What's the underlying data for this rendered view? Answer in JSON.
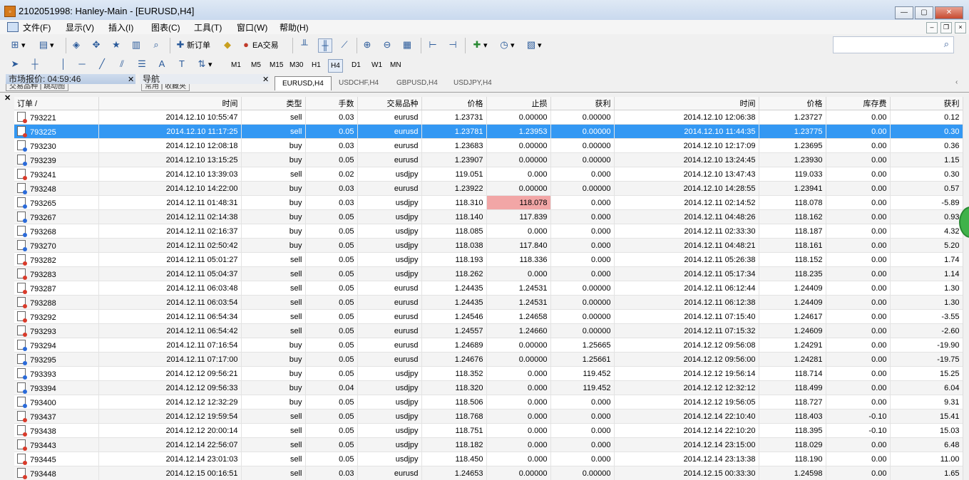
{
  "window": {
    "title": "2102051998: Hanley-Main - [EURUSD,H4]",
    "minimize": "—",
    "maximize": "▢",
    "close": "✕"
  },
  "menu": [
    "文件(F)",
    "显示(V)",
    "插入(I)",
    "图表(C)",
    "工具(T)",
    "窗口(W)",
    "帮助(H)"
  ],
  "toolbar": {
    "new_order": "新订单",
    "ea_trading": "EA交易"
  },
  "search": {
    "value": ""
  },
  "timeframes": [
    "M1",
    "M5",
    "M15",
    "M30",
    "H1",
    "H4",
    "D1",
    "W1",
    "MN"
  ],
  "active_timeframe": "H4",
  "panels": {
    "market_watch": "市场报价: 04:59:46",
    "navigator": "导航",
    "market_tabs": "交易品种 | 跳动图",
    "nav_tabs": "常用 | 收藏夹"
  },
  "chart_tabs": [
    "EURUSD,H4",
    "USDCHF,H4",
    "GBPUSD,H4",
    "USDJPY,H4"
  ],
  "table": {
    "headers": [
      "订单 /",
      "时间",
      "类型",
      "手数",
      "交易品种",
      "价格",
      "止损",
      "获利",
      "时间",
      "价格",
      "库存费",
      "获利"
    ],
    "rows": [
      {
        "o": "793221",
        "t1": "2014.12.10 10:55:47",
        "type": "sell",
        "lots": "0.03",
        "sym": "eurusd",
        "p1": "1.23731",
        "sl": "0.00000",
        "tp": "0.00000",
        "t2": "2014.12.10 12:06:38",
        "p2": "1.23727",
        "sw": "0.00",
        "pr": "0.12"
      },
      {
        "o": "793225",
        "t1": "2014.12.10 11:17:25",
        "type": "sell",
        "lots": "0.05",
        "sym": "eurusd",
        "p1": "1.23781",
        "sl": "1.23953",
        "tp": "0.00000",
        "t2": "2014.12.10 11:44:35",
        "p2": "1.23775",
        "sw": "0.00",
        "pr": "0.30"
      },
      {
        "o": "793230",
        "t1": "2014.12.10 12:08:18",
        "type": "buy",
        "lots": "0.03",
        "sym": "eurusd",
        "p1": "1.23683",
        "sl": "0.00000",
        "tp": "0.00000",
        "t2": "2014.12.10 12:17:09",
        "p2": "1.23695",
        "sw": "0.00",
        "pr": "0.36"
      },
      {
        "o": "793239",
        "t1": "2014.12.10 13:15:25",
        "type": "buy",
        "lots": "0.05",
        "sym": "eurusd",
        "p1": "1.23907",
        "sl": "0.00000",
        "tp": "0.00000",
        "t2": "2014.12.10 13:24:45",
        "p2": "1.23930",
        "sw": "0.00",
        "pr": "1.15"
      },
      {
        "o": "793241",
        "t1": "2014.12.10 13:39:03",
        "type": "sell",
        "lots": "0.02",
        "sym": "usdjpy",
        "p1": "119.051",
        "sl": "0.000",
        "tp": "0.000",
        "t2": "2014.12.10 13:47:43",
        "p2": "119.033",
        "sw": "0.00",
        "pr": "0.30"
      },
      {
        "o": "793248",
        "t1": "2014.12.10 14:22:00",
        "type": "buy",
        "lots": "0.03",
        "sym": "eurusd",
        "p1": "1.23922",
        "sl": "0.00000",
        "tp": "0.00000",
        "t2": "2014.12.10 14:28:55",
        "p2": "1.23941",
        "sw": "0.00",
        "pr": "0.57"
      },
      {
        "o": "793265",
        "t1": "2014.12.11 01:48:31",
        "type": "buy",
        "lots": "0.03",
        "sym": "usdjpy",
        "p1": "118.310",
        "sl": "118.078",
        "tp": "0.000",
        "t2": "2014.12.11 02:14:52",
        "p2": "118.078",
        "sw": "0.00",
        "pr": "-5.89"
      },
      {
        "o": "793267",
        "t1": "2014.12.11 02:14:38",
        "type": "buy",
        "lots": "0.05",
        "sym": "usdjpy",
        "p1": "118.140",
        "sl": "117.839",
        "tp": "0.000",
        "t2": "2014.12.11 04:48:26",
        "p2": "118.162",
        "sw": "0.00",
        "pr": "0.93"
      },
      {
        "o": "793268",
        "t1": "2014.12.11 02:16:37",
        "type": "buy",
        "lots": "0.05",
        "sym": "usdjpy",
        "p1": "118.085",
        "sl": "0.000",
        "tp": "0.000",
        "t2": "2014.12.11 02:33:30",
        "p2": "118.187",
        "sw": "0.00",
        "pr": "4.32"
      },
      {
        "o": "793270",
        "t1": "2014.12.11 02:50:42",
        "type": "buy",
        "lots": "0.05",
        "sym": "usdjpy",
        "p1": "118.038",
        "sl": "117.840",
        "tp": "0.000",
        "t2": "2014.12.11 04:48:21",
        "p2": "118.161",
        "sw": "0.00",
        "pr": "5.20"
      },
      {
        "o": "793282",
        "t1": "2014.12.11 05:01:27",
        "type": "sell",
        "lots": "0.05",
        "sym": "usdjpy",
        "p1": "118.193",
        "sl": "118.336",
        "tp": "0.000",
        "t2": "2014.12.11 05:26:38",
        "p2": "118.152",
        "sw": "0.00",
        "pr": "1.74"
      },
      {
        "o": "793283",
        "t1": "2014.12.11 05:04:37",
        "type": "sell",
        "lots": "0.05",
        "sym": "usdjpy",
        "p1": "118.262",
        "sl": "0.000",
        "tp": "0.000",
        "t2": "2014.12.11 05:17:34",
        "p2": "118.235",
        "sw": "0.00",
        "pr": "1.14"
      },
      {
        "o": "793287",
        "t1": "2014.12.11 06:03:48",
        "type": "sell",
        "lots": "0.05",
        "sym": "eurusd",
        "p1": "1.24435",
        "sl": "1.24531",
        "tp": "0.00000",
        "t2": "2014.12.11 06:12:44",
        "p2": "1.24409",
        "sw": "0.00",
        "pr": "1.30"
      },
      {
        "o": "793288",
        "t1": "2014.12.11 06:03:54",
        "type": "sell",
        "lots": "0.05",
        "sym": "eurusd",
        "p1": "1.24435",
        "sl": "1.24531",
        "tp": "0.00000",
        "t2": "2014.12.11 06:12:38",
        "p2": "1.24409",
        "sw": "0.00",
        "pr": "1.30"
      },
      {
        "o": "793292",
        "t1": "2014.12.11 06:54:34",
        "type": "sell",
        "lots": "0.05",
        "sym": "eurusd",
        "p1": "1.24546",
        "sl": "1.24658",
        "tp": "0.00000",
        "t2": "2014.12.11 07:15:40",
        "p2": "1.24617",
        "sw": "0.00",
        "pr": "-3.55"
      },
      {
        "o": "793293",
        "t1": "2014.12.11 06:54:42",
        "type": "sell",
        "lots": "0.05",
        "sym": "eurusd",
        "p1": "1.24557",
        "sl": "1.24660",
        "tp": "0.00000",
        "t2": "2014.12.11 07:15:32",
        "p2": "1.24609",
        "sw": "0.00",
        "pr": "-2.60"
      },
      {
        "o": "793294",
        "t1": "2014.12.11 07:16:54",
        "type": "buy",
        "lots": "0.05",
        "sym": "eurusd",
        "p1": "1.24689",
        "sl": "0.00000",
        "tp": "1.25665",
        "t2": "2014.12.12 09:56:08",
        "p2": "1.24291",
        "sw": "0.00",
        "pr": "-19.90"
      },
      {
        "o": "793295",
        "t1": "2014.12.11 07:17:00",
        "type": "buy",
        "lots": "0.05",
        "sym": "eurusd",
        "p1": "1.24676",
        "sl": "0.00000",
        "tp": "1.25661",
        "t2": "2014.12.12 09:56:00",
        "p2": "1.24281",
        "sw": "0.00",
        "pr": "-19.75"
      },
      {
        "o": "793393",
        "t1": "2014.12.12 09:56:21",
        "type": "buy",
        "lots": "0.05",
        "sym": "usdjpy",
        "p1": "118.352",
        "sl": "0.000",
        "tp": "119.452",
        "t2": "2014.12.12 19:56:14",
        "p2": "118.714",
        "sw": "0.00",
        "pr": "15.25"
      },
      {
        "o": "793394",
        "t1": "2014.12.12 09:56:33",
        "type": "buy",
        "lots": "0.04",
        "sym": "usdjpy",
        "p1": "118.320",
        "sl": "0.000",
        "tp": "119.452",
        "t2": "2014.12.12 12:32:12",
        "p2": "118.499",
        "sw": "0.00",
        "pr": "6.04"
      },
      {
        "o": "793400",
        "t1": "2014.12.12 12:32:29",
        "type": "buy",
        "lots": "0.05",
        "sym": "usdjpy",
        "p1": "118.506",
        "sl": "0.000",
        "tp": "0.000",
        "t2": "2014.12.12 19:56:05",
        "p2": "118.727",
        "sw": "0.00",
        "pr": "9.31"
      },
      {
        "o": "793437",
        "t1": "2014.12.12 19:59:54",
        "type": "sell",
        "lots": "0.05",
        "sym": "usdjpy",
        "p1": "118.768",
        "sl": "0.000",
        "tp": "0.000",
        "t2": "2014.12.14 22:10:40",
        "p2": "118.403",
        "sw": "-0.10",
        "pr": "15.41"
      },
      {
        "o": "793438",
        "t1": "2014.12.12 20:00:14",
        "type": "sell",
        "lots": "0.05",
        "sym": "usdjpy",
        "p1": "118.751",
        "sl": "0.000",
        "tp": "0.000",
        "t2": "2014.12.14 22:10:20",
        "p2": "118.395",
        "sw": "-0.10",
        "pr": "15.03"
      },
      {
        "o": "793443",
        "t1": "2014.12.14 22:56:07",
        "type": "sell",
        "lots": "0.05",
        "sym": "usdjpy",
        "p1": "118.182",
        "sl": "0.000",
        "tp": "0.000",
        "t2": "2014.12.14 23:15:00",
        "p2": "118.029",
        "sw": "0.00",
        "pr": "6.48"
      },
      {
        "o": "793445",
        "t1": "2014.12.14 23:01:03",
        "type": "sell",
        "lots": "0.05",
        "sym": "usdjpy",
        "p1": "118.450",
        "sl": "0.000",
        "tp": "0.000",
        "t2": "2014.12.14 23:13:38",
        "p2": "118.190",
        "sw": "0.00",
        "pr": "11.00"
      },
      {
        "o": "793448",
        "t1": "2014.12.15 00:16:51",
        "type": "sell",
        "lots": "0.03",
        "sym": "eurusd",
        "p1": "1.24653",
        "sl": "0.00000",
        "tp": "0.00000",
        "t2": "2014.12.15 00:33:30",
        "p2": "1.24598",
        "sw": "0.00",
        "pr": "1.65"
      }
    ],
    "selected_row": 1,
    "highlighted_sl_row": 6
  },
  "colors": {
    "selection": "#3398f3",
    "sl_highlight": "#f2a6a6",
    "sell_dot": "#d93a2a",
    "buy_dot": "#2a6ad9"
  }
}
